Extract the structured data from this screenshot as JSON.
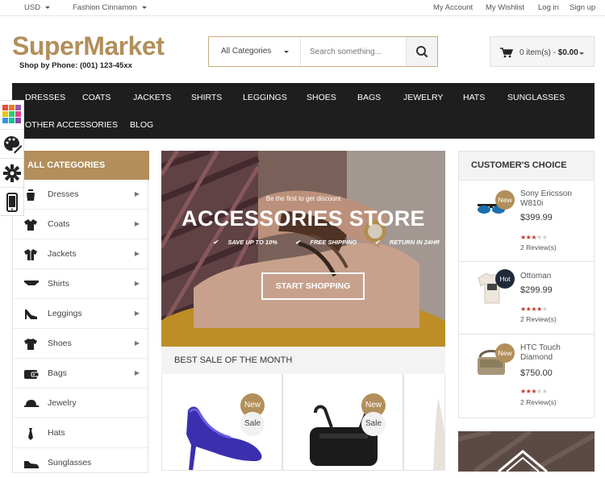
{
  "topbar": {
    "currency": "USD",
    "theme": "Fashion Cinnamon",
    "links": [
      "My Account",
      "My Wishlist",
      "Log in",
      "Sign up"
    ]
  },
  "header": {
    "logo": "SuperMarket",
    "phone": "Shop by Phone: (001) 123-45xx",
    "search": {
      "category": "All Categories",
      "placeholder": "Search something..."
    },
    "cart": {
      "items": "0 item(s) - ",
      "total": "$0.00"
    }
  },
  "nav": {
    "items": [
      "DRESSES",
      "COATS",
      "JACKETS",
      "SHIRTS",
      "LEGGINGS",
      "SHOES",
      "BAGS",
      "JEWELRY",
      "HATS",
      "SUNGLASSES",
      "OTHER ACCESSORIES",
      "BLOG"
    ]
  },
  "sidebar": {
    "title": "ALL CATEGORIES",
    "items": [
      {
        "label": "Dresses",
        "icon": "dress-icon",
        "has_submenu": true
      },
      {
        "label": "Coats",
        "icon": "coat-icon",
        "has_submenu": true
      },
      {
        "label": "Jackets",
        "icon": "jacket-icon",
        "has_submenu": true
      },
      {
        "label": "Shirts",
        "icon": "shirt-icon",
        "has_submenu": true
      },
      {
        "label": "Leggings",
        "icon": "heel-icon",
        "has_submenu": true
      },
      {
        "label": "Shoes",
        "icon": "tshirt-icon",
        "has_submenu": true
      },
      {
        "label": "Bags",
        "icon": "wallet-icon",
        "has_submenu": true
      },
      {
        "label": "Jewelry",
        "icon": "cap-icon",
        "has_submenu": false
      },
      {
        "label": "Hats",
        "icon": "tie-icon",
        "has_submenu": false
      },
      {
        "label": "Sunglasses",
        "icon": "shoe-icon",
        "has_submenu": false
      }
    ]
  },
  "banner": {
    "kicker": "Be the first to get discount",
    "title": "ACCESSORIES STORE",
    "features": [
      "SAVE UP TO 10%",
      "FREE SHIPPING",
      "RETURN IN 24HR"
    ],
    "cta": "START SHOPPING"
  },
  "best_sale": {
    "title": "BEST SALE OF THE MONTH",
    "products": [
      {
        "badges": [
          "New",
          "Sale"
        ],
        "image": "blue-heel-shoe"
      },
      {
        "badges": [
          "New",
          "Sale"
        ],
        "image": "black-shoulder-bag"
      }
    ]
  },
  "customers_choice": {
    "title": "CUSTOMER'S CHOICE",
    "items": [
      {
        "name": "Sony Ericsson W810i",
        "price": "$399.99",
        "rating": 3.5,
        "reviews": "2 Review(s)",
        "badge": "New",
        "image": "sunglasses"
      },
      {
        "name": "Ottoman",
        "price": "$299.99",
        "rating": 4,
        "reviews": "2 Review(s)",
        "badge": "Hot",
        "image": "sweater"
      },
      {
        "name": "HTC Touch Diamond",
        "price": "$750.00",
        "rating": 3.5,
        "reviews": "2 Review(s)",
        "badge": "New",
        "image": "messenger-bag"
      }
    ]
  },
  "colors": {
    "accent": "#b28f5b",
    "nav_bg": "#1e1e1e",
    "hot_badge": "#1e2a39",
    "star": "#c0392b"
  }
}
